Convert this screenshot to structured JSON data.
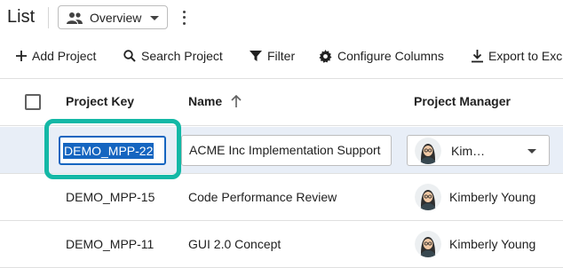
{
  "header": {
    "title": "List",
    "view_select": {
      "value": "Overview",
      "icon": "people-icon"
    }
  },
  "toolbar": {
    "add_project": "Add Project",
    "search_project": "Search Project",
    "filter": "Filter",
    "configure_columns": "Configure Columns",
    "export": "Export to Exc"
  },
  "table": {
    "columns": {
      "key": "Project Key",
      "name": "Name",
      "manager": "Project Manager"
    },
    "edit_row": {
      "key": "DEMO_MPP-22",
      "name": "ACME Inc Implementation Support",
      "manager": "Kim…"
    },
    "rows": [
      {
        "key": "DEMO_MPP-15",
        "name": "Code Performance Review",
        "manager": "Kimberly Young"
      },
      {
        "key": "DEMO_MPP-11",
        "name": "GUI 2.0 Concept",
        "manager": "Kimberly Young"
      }
    ]
  },
  "colors": {
    "focus_ring": "#14b8a6",
    "selection": "#1565c0",
    "selected_row": "#e8eef7"
  }
}
